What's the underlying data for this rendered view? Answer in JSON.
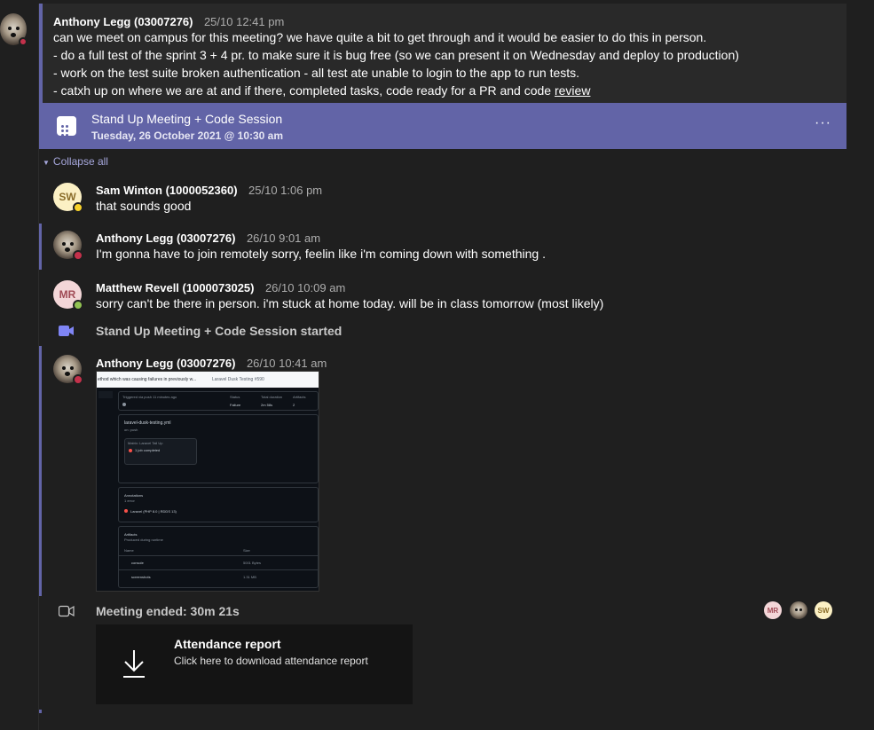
{
  "root": {
    "author": "Anthony Legg (03007276)",
    "time": "25/10 12:41 pm",
    "lines": [
      "can we meet on campus for this meeting? we have quite a bit to get through and it would be easier to do this in person.",
      "- do a full test of the sprint 3 + 4 pr. to make sure it is bug free (so we can present it on Wednesday and deploy to production)",
      "- work on the test suite broken authentication - all test ate unable to login to the app to run tests.",
      "- catxh up on where we are at and if there, completed tasks, code ready for a PR and code "
    ],
    "link": "review"
  },
  "meeting": {
    "title": "Stand Up Meeting + Code Session",
    "datetime": "Tuesday, 26 October 2021 @ 10:30 am",
    "more": "···"
  },
  "collapse": "Collapse all",
  "replies": [
    {
      "initials": "SW",
      "author": "Sam Winton (1000052360)",
      "time": "25/10 1:06 pm",
      "text": "that sounds good",
      "avatar_color": "#fbf0c4",
      "status": "away"
    },
    {
      "author": "Anthony Legg (03007276)",
      "time": "26/10 9:01 am",
      "text": "I'm gonna have to join remotely sorry, feelin like i'm coming down with something .",
      "status": "busy"
    },
    {
      "initials": "MR",
      "author": "Matthew Revell (1000073025)",
      "time": "26/10 10:09 am",
      "text": "sorry can't be there in person. i'm stuck at home today. will be in class tomorrow (most likely)",
      "avatar_color": "#f3d6d8",
      "status": "available"
    }
  ],
  "started": "Stand Up Meeting + Code Session started",
  "image_reply": {
    "author": "Anthony Legg (03007276)",
    "time": "26/10 10:41 am",
    "screenshot": {
      "header": "ethod which was causing failures in previously w...",
      "header_link": "Laravel Dusk Testing #590",
      "trigger": "Triggered via push 11 minutes ago",
      "status_label": "Status",
      "status_value": "Failure",
      "duration_label": "Total duration",
      "duration_value": "2m 58s",
      "artifacts_label": "Artifacts",
      "artifacts_value": "2",
      "workflow": "laravel-dusk-testing.yml",
      "on": "on: push",
      "job": "Matrix: Laravel Tail Up",
      "job_item": "1 job completed",
      "annotations": "Annotations",
      "annotations_sub": "1 error",
      "annotation_item": "Laravel (PHP 8.0 | RDDS 13)",
      "artifacts_title": "Artifacts",
      "artifacts_sub": "Produced during runtime",
      "col_name": "Name",
      "col_size": "Size",
      "artifact1": "console",
      "artifact1_size": "5001 Bytes",
      "artifact2": "screenshots",
      "artifact2_size": "1.31 MB"
    }
  },
  "ended": {
    "text": "Meeting ended: 30m 21s",
    "participants": [
      {
        "initials": "MR",
        "color": "#f3d6d8"
      },
      {
        "initials": "",
        "color": "dog"
      },
      {
        "initials": "SW",
        "color": "#fbf0c4"
      }
    ]
  },
  "attendance": {
    "title": "Attendance report",
    "subtitle": "Click here to download attendance report"
  }
}
